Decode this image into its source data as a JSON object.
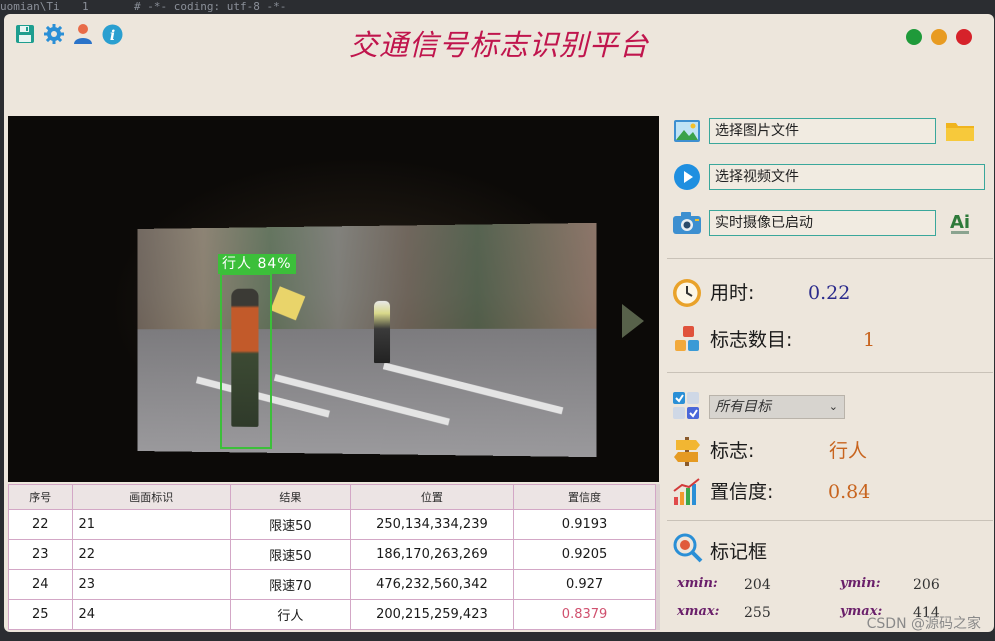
{
  "editor": {
    "tab_fragment": "uomian\\Ti",
    "line_number": "1",
    "code_line": "# -*- coding: utf-8 -*-"
  },
  "window": {
    "title": "交通信号标志识别平台",
    "controls": {
      "colors": [
        "#1f9a3a",
        "#e89b21",
        "#d6222a"
      ]
    }
  },
  "toolbar_icons": [
    "save-icon",
    "settings-icon",
    "user-icon",
    "info-icon"
  ],
  "video": {
    "detection_label": "行人 84%"
  },
  "table": {
    "headers": [
      "序号",
      "画面标识",
      "结果",
      "位置",
      "置信度"
    ],
    "rows": [
      [
        "22",
        "21",
        "限速50",
        "250,134,334,239",
        "0.9193"
      ],
      [
        "23",
        "22",
        "限速50",
        "186,170,263,269",
        "0.9205"
      ],
      [
        "24",
        "23",
        "限速70",
        "476,232,560,342",
        "0.927"
      ],
      [
        "25",
        "24",
        "行人",
        "200,215,259,423",
        "0.8379"
      ]
    ]
  },
  "panel": {
    "image_file": "选择图片文件",
    "video_file": "选择视频文件",
    "camera": "实时摄像已启动",
    "time_label": "用时:",
    "time_value": "0.22",
    "count_label": "标志数目:",
    "count_value": "1",
    "target_select": "所有目标",
    "sign_label": "标志:",
    "sign_value": "行人",
    "confidence_label": "置信度:",
    "confidence_value": "0.84",
    "bbox_title": "标记框",
    "xmin_label": "xmin:",
    "xmin": "204",
    "ymin_label": "ymin:",
    "ymin": "206",
    "xmax_label": "xmax:",
    "xmax": "255",
    "ymax_label": "ymax:",
    "ymax": "414"
  },
  "colors": {
    "title": "#c0154d",
    "value_blue": "#2b2b8c",
    "value_orange": "#c8641e",
    "detection_box": "#3cbf3a"
  },
  "watermark": "CSDN @源码之家"
}
